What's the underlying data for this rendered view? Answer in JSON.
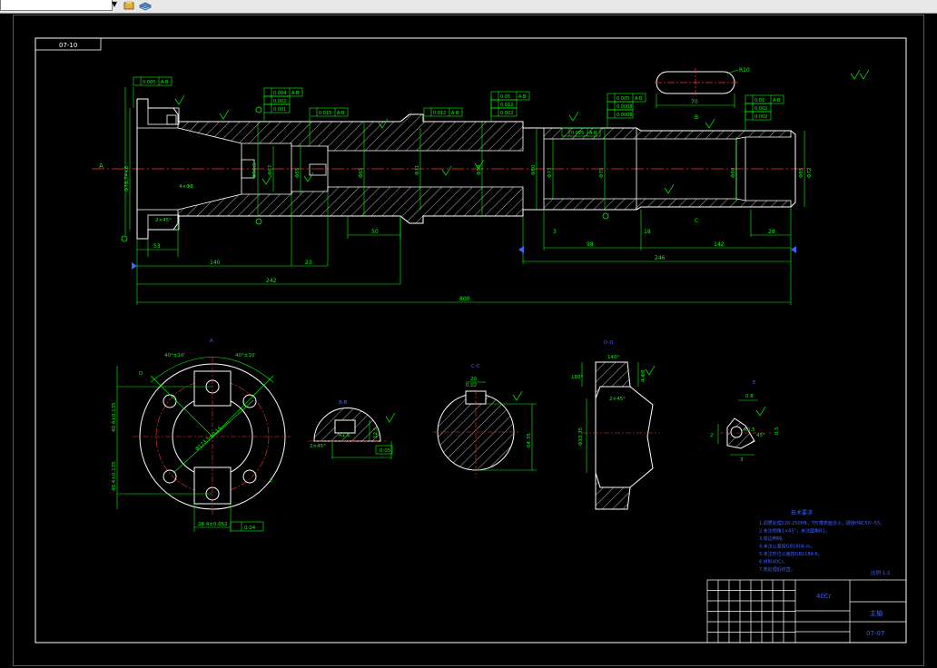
{
  "toolbar": {
    "combo_arrow": "▼",
    "icons": [
      "layer-icon",
      "layers-stack-icon"
    ]
  },
  "drawing": {
    "sheet_code": "07-10",
    "main_view": {
      "gdt_left": [
        "0.005",
        "A-B"
      ],
      "gdt_mid1": [
        "0.004",
        "A-B",
        "0.002",
        "0.001"
      ],
      "gdt_mid2": [
        "0.015",
        "A-B"
      ],
      "gdt_mid3": [
        "0.012",
        "A-B"
      ],
      "gdt_mid4": [
        "0.05",
        "A-B",
        "0.012",
        "0.002"
      ],
      "gdt_mid5": [
        "0.005",
        "A-B",
        "0.0008",
        "0.0008"
      ],
      "gdt_mid6": [
        "0.025",
        "A-B"
      ],
      "gdt_right": [
        "0.01",
        "A-B",
        "0.002",
        "0.002"
      ],
      "key_r": "R10",
      "key_w": "70",
      "sec_b": "B",
      "sec_c": "C",
      "label_a": "A",
      "dims_bottom": [
        "53",
        "140",
        "23",
        "242",
        "800",
        "50",
        "3",
        "98",
        "18",
        "142",
        "28",
        "246"
      ],
      "dia_labels": [
        "Φ78.74×6",
        "Φ56.5",
        "Φ67",
        "Φ55",
        "Φ65",
        "Φ71",
        "Φ59",
        "Φ80",
        "Φ73",
        "Φ75",
        "Φ80",
        "Φ85",
        "Φ72"
      ],
      "note_left": "4×Φ8",
      "chamfer": "2×45°"
    },
    "flange_view": {
      "title": "A",
      "angle1": "40°±10'",
      "angle2": "40°±10'",
      "dia": "Φ173.5±0.15",
      "dim_v1": "40.4±0.135",
      "dim_v2": "40.4±0.135",
      "bottom": "28.4±0.052",
      "tol": "0.04",
      "d_label": "D",
      "e_label": "E"
    },
    "section_bb": {
      "title": "B-B",
      "r": "R1.6",
      "h": "12.5",
      "w": "0.05",
      "c": "2×45°"
    },
    "section_cc": {
      "title": "C-C",
      "w": "20",
      "h": "64.35",
      "t": "0.02"
    },
    "section_dd": {
      "title": "D-D",
      "a": "140°",
      "b": "180°",
      "c": "2×45°",
      "d": "Φ93.35",
      "e": "4-Φ8"
    },
    "detail_e": {
      "title": "E",
      "a": "0.8",
      "r": "R0.5",
      "b": "3",
      "c": "45°",
      "d": "0.5",
      "e": "2"
    },
    "notes": {
      "title": "技术要求",
      "lines": [
        "1.调质处理220-250HB，T形槽表面淬火，硬度HRC50~55。",
        "2.未注倒角1×45°，未注圆角R1。",
        "3.锐边倒钝。",
        "4.未注公差按GB1804-m。",
        "5.未注形位公差按GB1184-K。",
        "6.材料40Cr。",
        "7.热处理后校直。"
      ],
      "scale": "比例 1:1"
    },
    "title_block": {
      "material": "40Cr",
      "name": "主轴",
      "code": "07-07"
    }
  }
}
